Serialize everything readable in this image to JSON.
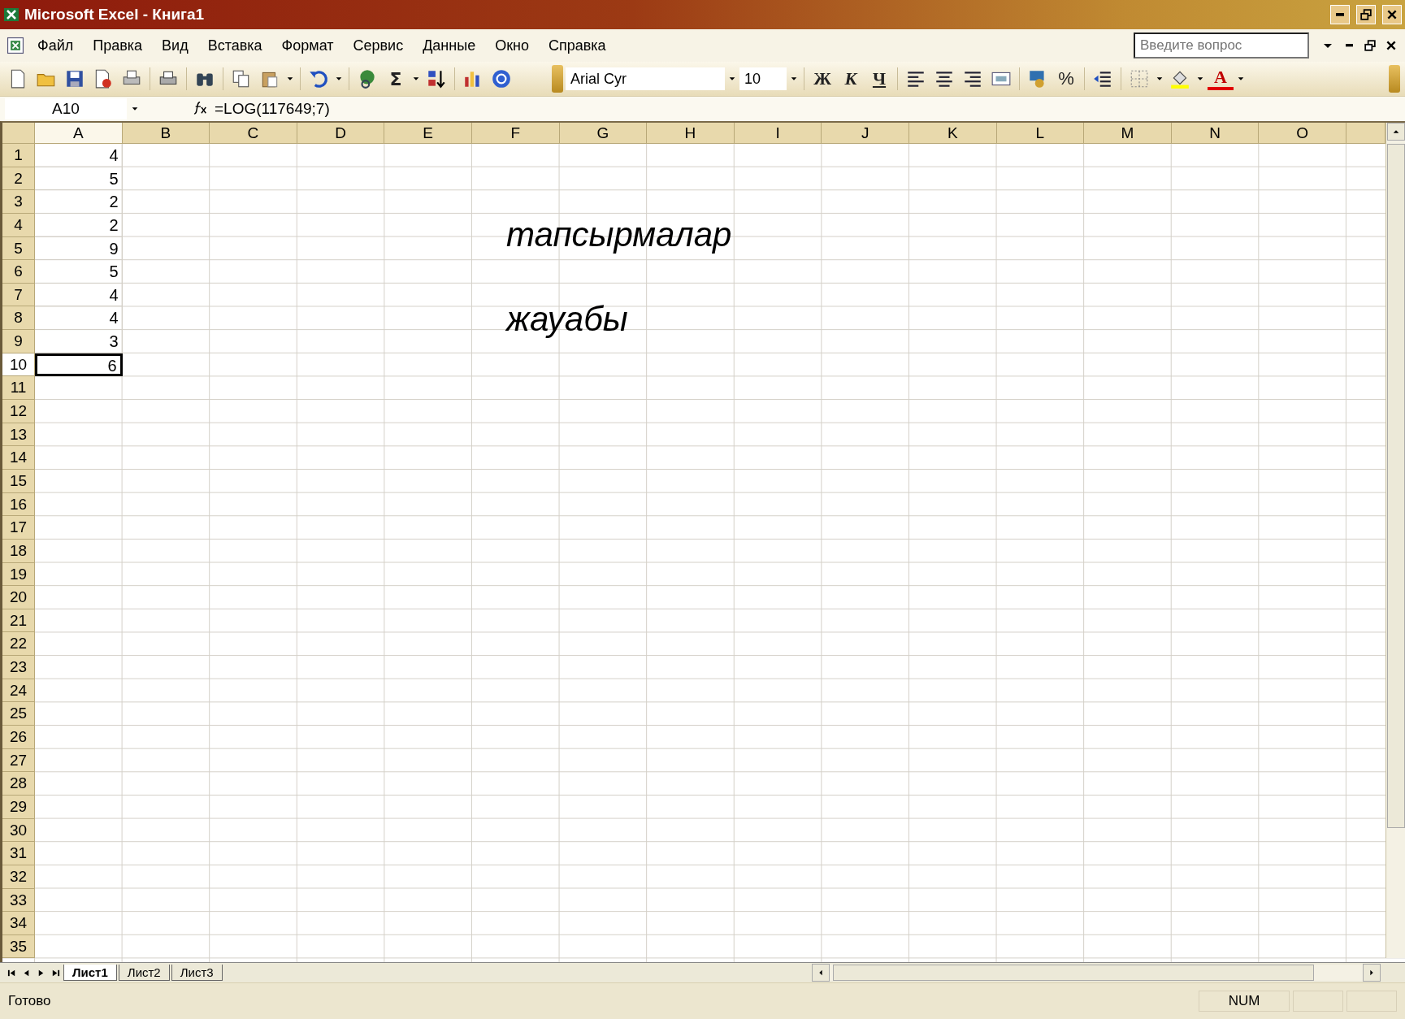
{
  "window": {
    "title": "Microsoft Excel - Книга1"
  },
  "menu": [
    {
      "label": "Файл"
    },
    {
      "label": "Правка"
    },
    {
      "label": "Вид"
    },
    {
      "label": "Вставка"
    },
    {
      "label": "Формат"
    },
    {
      "label": "Сервис"
    },
    {
      "label": "Данные"
    },
    {
      "label": "Окно"
    },
    {
      "label": "Справка"
    }
  ],
  "help_search": {
    "placeholder": "Введите вопрос"
  },
  "toolbar": {
    "sum": "Σ",
    "font": "Arial Cyr",
    "size": "10",
    "bold": "Ж",
    "italic": "К",
    "underline": "Ч",
    "percent": "%",
    "font_color": "A"
  },
  "formula_bar": {
    "name_box": "A10",
    "formula": "=LOG(117649;7)"
  },
  "columns": [
    {
      "label": "A",
      "selected": true
    },
    {
      "label": "B",
      "selected": false
    },
    {
      "label": "C",
      "selected": false
    },
    {
      "label": "D",
      "selected": false
    },
    {
      "label": "E",
      "selected": false
    },
    {
      "label": "F",
      "selected": false
    },
    {
      "label": "G",
      "selected": false
    },
    {
      "label": "H",
      "selected": false
    },
    {
      "label": "I",
      "selected": false
    },
    {
      "label": "J",
      "selected": false
    },
    {
      "label": "K",
      "selected": false
    },
    {
      "label": "L",
      "selected": false
    },
    {
      "label": "M",
      "selected": false
    },
    {
      "label": "N",
      "selected": false
    },
    {
      "label": "O",
      "selected": false
    }
  ],
  "rows": [
    {
      "label": "1",
      "selected": false,
      "cells": [
        "4"
      ]
    },
    {
      "label": "2",
      "selected": false,
      "cells": [
        "5"
      ]
    },
    {
      "label": "3",
      "selected": false,
      "cells": [
        "2"
      ]
    },
    {
      "label": "4",
      "selected": false,
      "cells": [
        "2"
      ]
    },
    {
      "label": "5",
      "selected": false,
      "cells": [
        "9"
      ]
    },
    {
      "label": "6",
      "selected": false,
      "cells": [
        "5"
      ]
    },
    {
      "label": "7",
      "selected": false,
      "cells": [
        "4"
      ]
    },
    {
      "label": "8",
      "selected": false,
      "cells": [
        "4"
      ]
    },
    {
      "label": "9",
      "selected": false,
      "cells": [
        "3"
      ]
    },
    {
      "label": "10",
      "selected": true,
      "cells": [
        "6"
      ]
    },
    {
      "label": "11",
      "selected": false
    },
    {
      "label": "12",
      "selected": false
    },
    {
      "label": "13",
      "selected": false
    },
    {
      "label": "14",
      "selected": false
    },
    {
      "label": "15",
      "selected": false
    },
    {
      "label": "16",
      "selected": false
    },
    {
      "label": "17",
      "selected": false
    },
    {
      "label": "18",
      "selected": false
    },
    {
      "label": "19",
      "selected": false
    },
    {
      "label": "20",
      "selected": false
    },
    {
      "label": "21",
      "selected": false
    },
    {
      "label": "22",
      "selected": false
    },
    {
      "label": "23",
      "selected": false
    },
    {
      "label": "24",
      "selected": false
    },
    {
      "label": "25",
      "selected": false
    },
    {
      "label": "26",
      "selected": false
    },
    {
      "label": "27",
      "selected": false
    },
    {
      "label": "28",
      "selected": false
    },
    {
      "label": "29",
      "selected": false
    },
    {
      "label": "30",
      "selected": false
    },
    {
      "label": "31",
      "selected": false
    },
    {
      "label": "32",
      "selected": false
    },
    {
      "label": "33",
      "selected": false
    },
    {
      "label": "34",
      "selected": false
    },
    {
      "label": "35",
      "selected": false
    }
  ],
  "text_boxes": [
    "тапсырмалар",
    "жауабы"
  ],
  "sheet_tabs": [
    {
      "label": "Лист1",
      "selected": true
    },
    {
      "label": "Лист2",
      "selected": false
    },
    {
      "label": "Лист3",
      "selected": false
    }
  ],
  "status_bar": {
    "message": "Готово",
    "indicators": [
      "NUM"
    ]
  }
}
